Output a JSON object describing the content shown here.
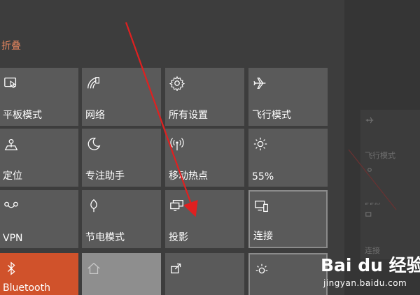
{
  "action_center": {
    "collapse_label": "折叠",
    "tiles": [
      {
        "label": "平板模式",
        "icon": "tablet-mode-icon"
      },
      {
        "label": "网络",
        "icon": "network-icon"
      },
      {
        "label": "所有设置",
        "icon": "settings-gear-icon"
      },
      {
        "label": "飞行模式",
        "icon": "airplane-icon"
      },
      {
        "label": "定位",
        "icon": "location-icon"
      },
      {
        "label": "专注助手",
        "icon": "moon-icon"
      },
      {
        "label": "移动热点",
        "icon": "mobile-hotspot-icon"
      },
      {
        "label": "55%",
        "icon": "brightness-sun-icon"
      },
      {
        "label": "VPN",
        "icon": "vpn-icon"
      },
      {
        "label": "节电模式",
        "icon": "battery-saver-icon"
      },
      {
        "label": "投影",
        "icon": "project-icon"
      },
      {
        "label": "连接",
        "icon": "connect-icon"
      },
      {
        "label": "Bluetooth",
        "icon": "bluetooth-icon"
      },
      {
        "label": "",
        "icon": "home-icon"
      },
      {
        "label": "",
        "icon": "share-icon"
      },
      {
        "label": "",
        "icon": "night-light-icon"
      }
    ]
  },
  "background_peek": {
    "labels": [
      "飞行模式",
      "55%",
      "连接"
    ]
  },
  "watermark": {
    "logo_text": "Bai du 经验",
    "site": "jingyan.baidu.com"
  },
  "colors": {
    "accent": "#d0522b",
    "collapse_text": "#e2845e",
    "tile": "#5a5a5a",
    "panel": "#3d3d3d",
    "annotation": "#e02020"
  }
}
